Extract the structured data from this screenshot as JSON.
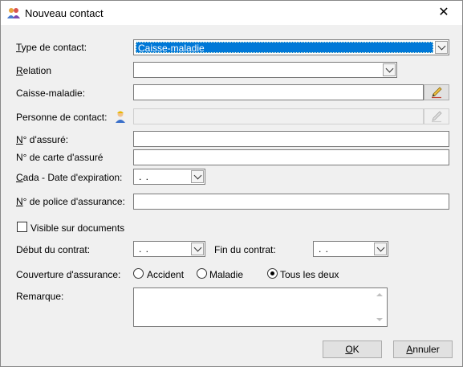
{
  "window": {
    "title": "Nouveau contact",
    "close_icon": "close-icon"
  },
  "form": {
    "type_contact": {
      "label_key": "T",
      "label_rest": "ype de contact:",
      "value": "Caisse-maladie"
    },
    "relation": {
      "label_key": "R",
      "label_rest": "elation",
      "value": ""
    },
    "caisse_maladie": {
      "label": "Caisse-maladie:",
      "value": ""
    },
    "personne_contact": {
      "label": "Personne de contact:",
      "value": ""
    },
    "numero_assure": {
      "label_key": "N",
      "label_rest": "° d'assuré:",
      "value": ""
    },
    "numero_carte": {
      "label": "N° de carte d'assuré",
      "value": ""
    },
    "cada": {
      "label_key": "C",
      "label_rest": "ada - Date d'expiration:",
      "value": ". ."
    },
    "numero_police": {
      "label_key": "N",
      "label_rest": "° de police d'assurance:",
      "value": ""
    },
    "visible_documents": {
      "label": "Visible sur documents",
      "checked": false
    },
    "debut_contrat": {
      "label": "Début du contrat:",
      "value": ". ."
    },
    "fin_contrat": {
      "label": "Fin du contrat:",
      "value": ". ."
    },
    "couverture": {
      "label": "Couverture d'assurance:",
      "options": [
        "Accident",
        "Maladie",
        "Tous les deux"
      ],
      "selected": "Tous les deux"
    },
    "remarque": {
      "label": "Remarque:",
      "value": ""
    }
  },
  "buttons": {
    "ok_key": "O",
    "ok_rest": "K",
    "annuler_key": "A",
    "annuler_rest": "nnuler"
  },
  "colors": {
    "selection": "#0078d7",
    "dialog_bg": "#f0f0f0"
  }
}
